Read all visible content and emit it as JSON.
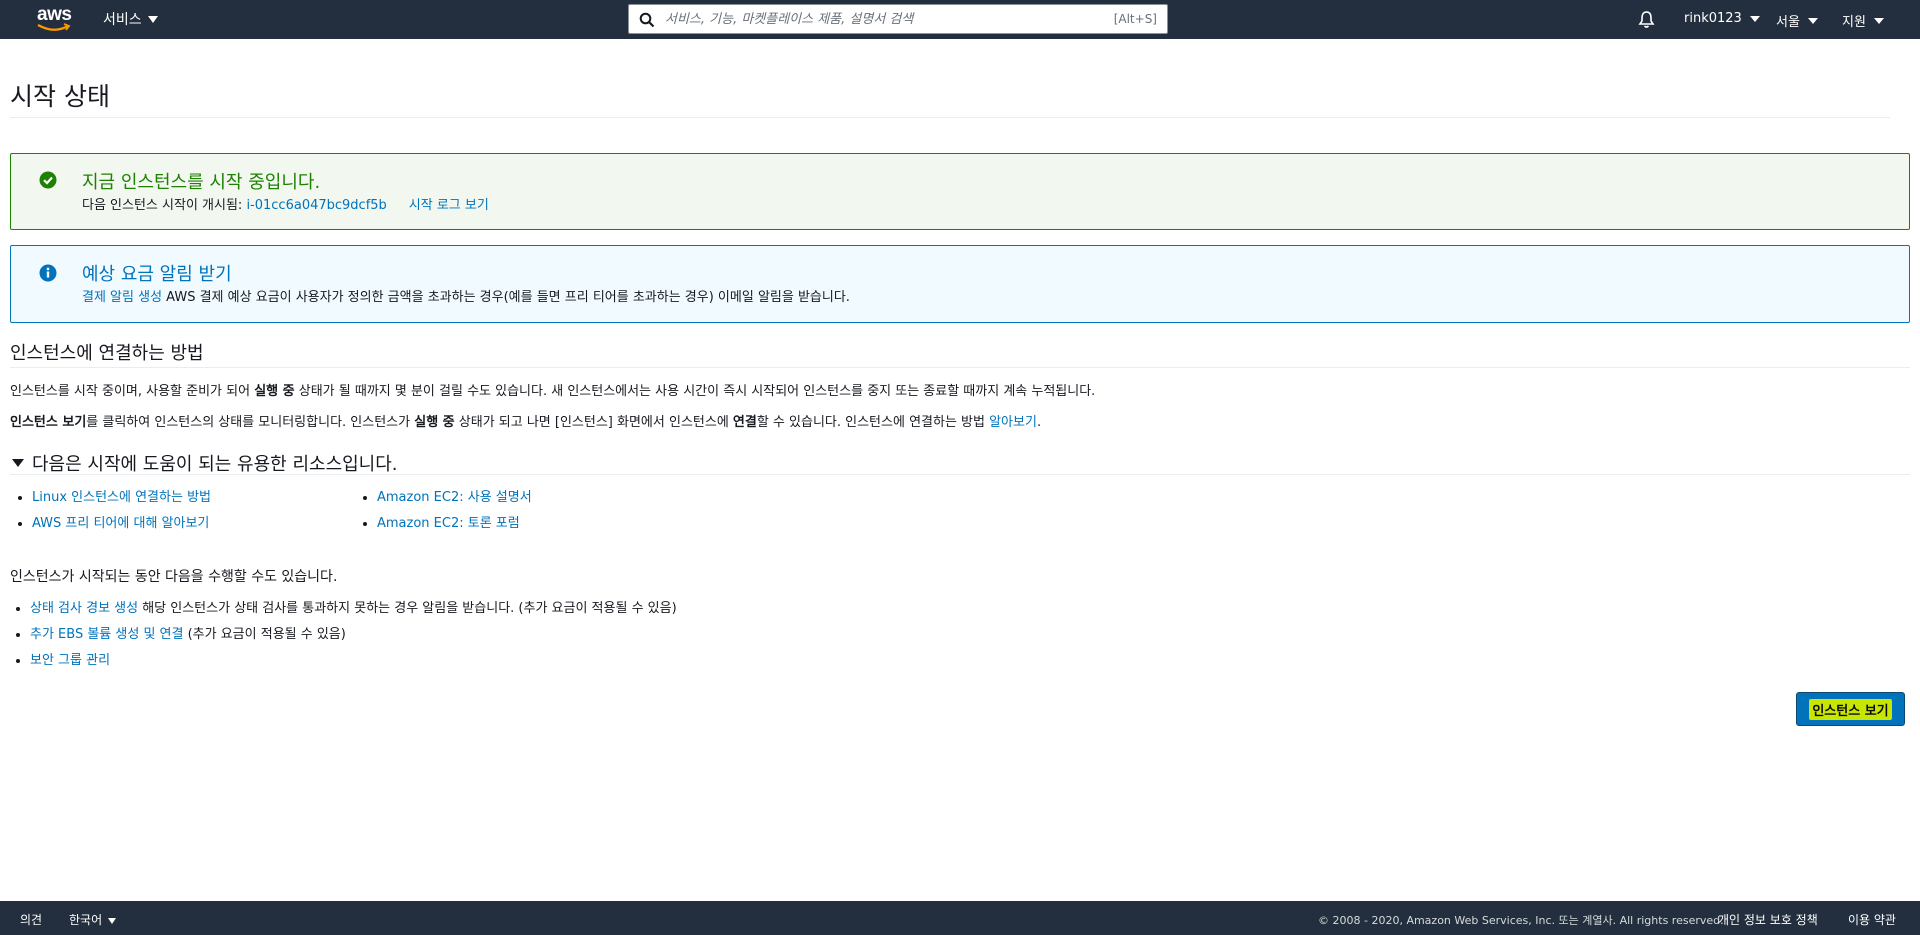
{
  "nav": {
    "logo_text": "aws",
    "services_label": "서비스",
    "search_placeholder": "서비스, 기능, 마켓플레이스 제품, 설명서 검색",
    "search_shortcut": "[Alt+S]",
    "user_label": "rink0123",
    "region_label": "서울",
    "support_label": "지원"
  },
  "page": {
    "title": "시작 상태"
  },
  "success_alert": {
    "title": "지금 인스턴스를 시작 중입니다.",
    "body_prefix": "다음 인스턴스 시작이 개시됨: ",
    "instance_id": "i-01cc6a047bc9dcf5b",
    "log_link": "시작 로그 보기"
  },
  "info_alert": {
    "title": "예상 요금 알림 받기",
    "link": "결제 알림 생성",
    "body": " AWS 결제 예상 요금이 사용자가 정의한 금액을 초과하는 경우(예를 들면 프리 티어를 초과하는 경우) 이메일 알림을 받습니다."
  },
  "connect": {
    "title": "인스턴스에 연결하는 방법",
    "p1_a": "인스턴스를 시작 중이며, 사용할 준비가 되어 ",
    "p1_b": "실행 중",
    "p1_c": " 상태가 될 때까지 몇 분이 걸릴 수도 있습니다. 새 인스턴스에서는 사용 시간이 즉시 시작되어 인스턴스를 중지 또는 종료할 때까지 계속 누적됩니다.",
    "p2_a": "인스턴스 보기",
    "p2_b": "를 클릭하여 인스턴스의 상태를 모니터링합니다. 인스턴스가 ",
    "p2_c": "실행 중",
    "p2_d": " 상태가 되고 나면 [인스턴스] 화면에서 인스턴스에 ",
    "p2_e": "연결",
    "p2_f": "할 수 있습니다. 인스턴스에 연결하는 방법 ",
    "p2_link": "알아보기",
    "p2_end": "."
  },
  "resources": {
    "title": "다음은 시작에 도움이 되는 유용한 리소스입니다.",
    "left": [
      "Linux 인스턴스에 연결하는 방법",
      "AWS 프리 티어에 대해 알아보기"
    ],
    "right": [
      "Amazon EC2: 사용 설명서",
      "Amazon EC2: 토론 포럼"
    ]
  },
  "tasks": {
    "intro": "인스턴스가 시작되는 동안 다음을 수행할 수도 있습니다.",
    "items": [
      {
        "link": "상태 검사 경보 생성",
        "text": " 해당 인스턴스가 상태 검사를 통과하지 못하는 경우 알림을 받습니다. (추가 요금이 적용될 수 있음)"
      },
      {
        "link": "추가 EBS 볼륨 생성 및 연결",
        "text": " (추가 요금이 적용될 수 있음)"
      },
      {
        "link": "보안 그룹 관리",
        "text": ""
      }
    ]
  },
  "view_instances_button": "인스턴스 보기",
  "footer": {
    "feedback": "의견",
    "language": "한국어",
    "copyright": "© 2008 - 2020, Amazon Web Services, Inc. 또는 계열사. All rights reserved.",
    "privacy": "개인 정보 보호 정책",
    "terms": "이용 약관"
  },
  "colors": {
    "nav_bg": "#232f3e",
    "success": "#1d8102",
    "info": "#0073bb",
    "link": "#0073bb",
    "button_highlight": "#c8e600"
  }
}
